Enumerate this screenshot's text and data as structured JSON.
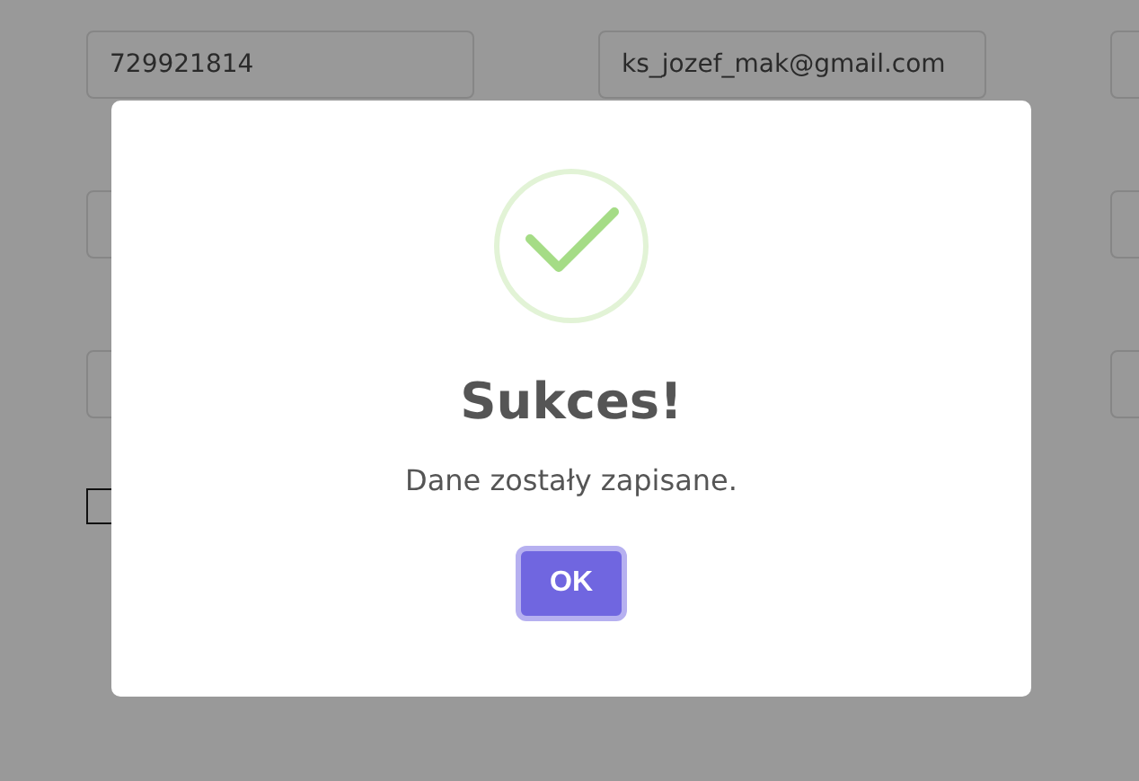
{
  "form": {
    "phone": {
      "value": "729921814"
    },
    "email": {
      "value": "ks_jozef_mak@gmail.com"
    },
    "consent": {
      "checked": false
    }
  },
  "dialog": {
    "title": "Sukces!",
    "message": "Dane zostały zapisane.",
    "button": "OK"
  }
}
